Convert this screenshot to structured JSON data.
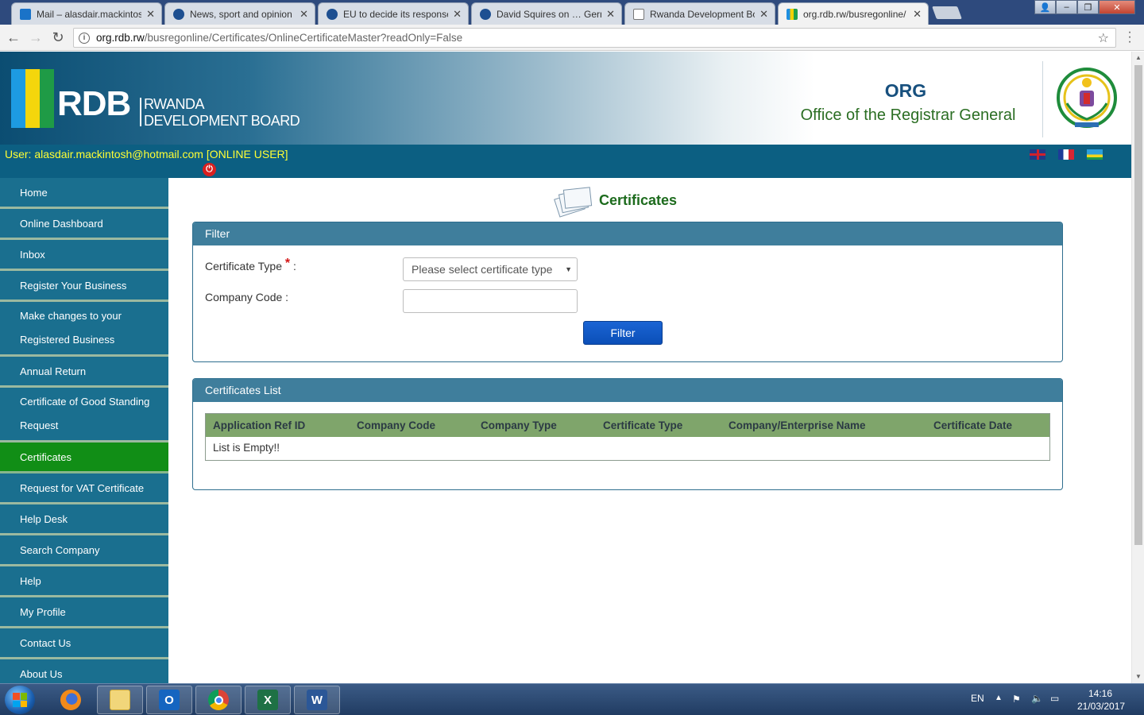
{
  "browser": {
    "tabs": [
      {
        "title": "Mail – alasdair.mackintos",
        "icon": "outlook-icon",
        "active": false
      },
      {
        "title": "News, sport and opinion",
        "icon": "guardian-icon",
        "active": false
      },
      {
        "title": "EU to decide its response",
        "icon": "guardian-icon",
        "active": false
      },
      {
        "title": "David Squires on … Germ",
        "icon": "guardian-icon",
        "active": false
      },
      {
        "title": "Rwanda Development Bo",
        "icon": "page-icon",
        "active": false
      },
      {
        "title": "org.rdb.rw/busregonline/",
        "icon": "rdb-favicon",
        "active": true
      }
    ],
    "url_host": "org.rdb.rw",
    "url_path": "/busregonline/Certificates/OnlineCertificateMaster?readOnly=False"
  },
  "header": {
    "logo_letters": "RDB",
    "logo_line1": "RWANDA",
    "logo_line2": "DEVELOPMENT BOARD",
    "org_title": "ORG",
    "org_subtitle": "Office of the Registrar General",
    "user_text": "User: alasdair.mackintosh@hotmail.com [ONLINE USER]"
  },
  "sidebar": {
    "items": [
      {
        "label": "Home"
      },
      {
        "label": "Online Dashboard"
      },
      {
        "label": "Inbox"
      },
      {
        "label": "Register Your Business"
      },
      {
        "label": "Make changes to your Registered Business"
      },
      {
        "label": "Annual Return"
      },
      {
        "label": "Certificate of Good Standing Request"
      },
      {
        "label": "Certificates"
      },
      {
        "label": "Request for VAT Certificate"
      },
      {
        "label": "Help Desk"
      },
      {
        "label": "Search Company"
      },
      {
        "label": "Help"
      },
      {
        "label": "My Profile"
      },
      {
        "label": "Contact Us"
      },
      {
        "label": "About Us"
      }
    ],
    "active_label": "Certificates"
  },
  "main": {
    "title": "Certificates",
    "filter": {
      "heading": "Filter",
      "certificate_type_label": "Certificate Type",
      "required_mark": "*",
      "label_suffix": ":",
      "certificate_type_value": "Please select certificate type",
      "company_code_label": "Company Code :",
      "company_code_value": "",
      "button": "Filter"
    },
    "list": {
      "heading": "Certificates List",
      "columns": [
        "Application Ref ID",
        "Company Code",
        "Company Type",
        "Certificate Type",
        "Company/Enterprise Name",
        "Certificate Date"
      ],
      "empty_text": "List is Empty!!"
    }
  },
  "taskbar": {
    "language": "EN",
    "time": "14:16",
    "date": "21/03/2017"
  },
  "colors": {
    "sidebar_bg": "#1a6f8f",
    "sidebar_active": "#118e16",
    "panel_head": "#3f7e9c",
    "table_head": "#7fa56b",
    "filter_button": "#0b4fb8",
    "user_text": "#ffff33"
  }
}
